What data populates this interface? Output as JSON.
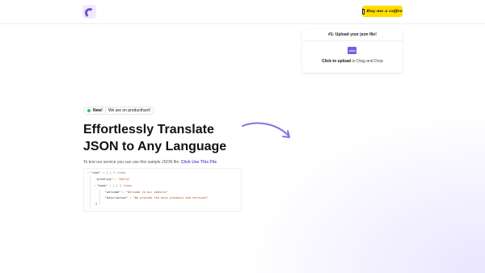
{
  "header": {
    "logo_icon": "app-logo-icon",
    "coffee_button_label": "Buy me a coffee",
    "coffee_color": "#ffdd00"
  },
  "upload": {
    "title": "#1: Upload your json file!",
    "file_icon_label": "JSON",
    "click_label": "Click to upload",
    "rest_label": " or Drag and Drop"
  },
  "hero": {
    "badge_new": "New!",
    "badge_text": "We are on producthunt!",
    "headline_line1": "Effortlessly Translate",
    "headline_line2": "JSON to Any Language",
    "sample_text": "To test our service you can use this sample JSON file: ",
    "sample_link": "Click Use This File",
    "accent_color": "#6d4fd6"
  },
  "json_preview": {
    "root_key": "\"root\"",
    "root_meta": "{ } 2 items",
    "greeting_key": "\"greeting\"",
    "greeting_value": "\"Hello\"",
    "home_key": "\"home\"",
    "home_meta": "{ } 2 items",
    "welcome_key": "\"welcome\"",
    "welcome_value": "\"Welcome to our website\"",
    "description_key": "\"description\"",
    "description_value": "\"We provide the best products and services\"",
    "close_brace": "}"
  }
}
